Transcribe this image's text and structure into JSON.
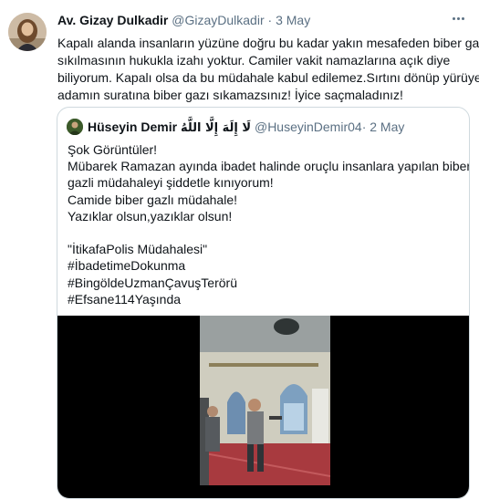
{
  "tweet": {
    "author_name": "Av. Gizay Dulkadir",
    "handle": "@GizayDulkadir",
    "separator": "·",
    "date": "3 May",
    "text_lines": [
      "Kapalı alanda insanların yüzüne doğru bu kadar yakın mesafeden biber gazı",
      "sıkılmasının hukukla izahı yoktur. Camiler vakit namazlarına açık diye",
      "biliyorum. Kapalı olsa da bu müdahale kabul edilemez.Sırtını dönüp yürüyen",
      "adamın suratına biber gazı sıkamazsınız! İyice saçmaladınız!"
    ],
    "more_icon": "more-horizontal-icon"
  },
  "quoted_tweet": {
    "author_name": "Hüseyin Demir",
    "arabic_name": "لَا إِلَهَ إِلَّا اللَّهُ",
    "handle": "@HuseyinDemir04",
    "separator": "·",
    "date": "2 May",
    "text_lines": [
      "Şok Görüntüler!",
      "Mübarek Ramazan ayında ibadet halinde oruçlu insanlara yapılan biber",
      "gazli müdahaleyi şiddetle kınıyorum!",
      "Camide biber gazlı müdahale!",
      "Yazıklar olsun,yazıklar olsun!",
      "",
      "\"İtikafaPolis Müdahalesi\"",
      "#İbadetimeDokunma",
      "#BingöldeUzmanÇavuşTerörü",
      "#Efsane114Yaşında"
    ]
  },
  "colors": {
    "text": "#0f1419",
    "muted": "#5b7083",
    "border": "#cfd9de",
    "background": "#ffffff"
  }
}
